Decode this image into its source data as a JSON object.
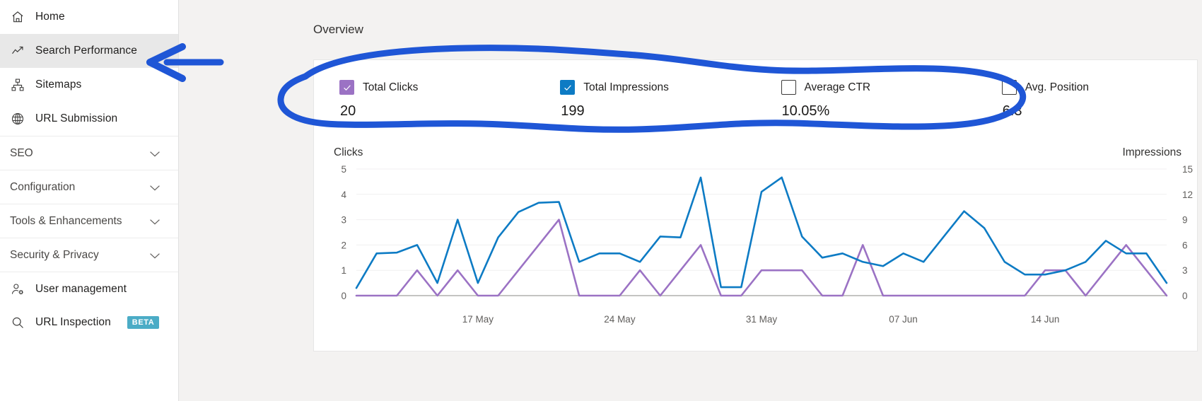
{
  "sidebar": {
    "items": [
      {
        "label": "Home",
        "icon": "home-icon",
        "type": "link",
        "active": false
      },
      {
        "label": "Search Performance",
        "icon": "trending-up-icon",
        "type": "link",
        "active": true
      },
      {
        "label": "Sitemaps",
        "icon": "sitemap-icon",
        "type": "link",
        "active": false
      },
      {
        "label": "URL Submission",
        "icon": "globe-icon",
        "type": "link",
        "active": false
      },
      {
        "label": "SEO",
        "icon": "chevron-down-icon",
        "type": "group",
        "active": false
      },
      {
        "label": "Configuration",
        "icon": "chevron-down-icon",
        "type": "group",
        "active": false
      },
      {
        "label": "Tools & Enhancements",
        "icon": "chevron-down-icon",
        "type": "group",
        "active": false
      },
      {
        "label": "Security & Privacy",
        "icon": "chevron-down-icon",
        "type": "group",
        "active": false
      },
      {
        "label": "User management",
        "icon": "user-settings-icon",
        "type": "link",
        "active": false
      },
      {
        "label": "URL Inspection",
        "icon": "search-icon",
        "type": "link",
        "active": false,
        "badge": "BETA"
      }
    ]
  },
  "main": {
    "page_title": "Overview",
    "metrics": [
      {
        "label": "Total Clicks",
        "value": "20",
        "checked": true,
        "color": "#9b72c4"
      },
      {
        "label": "Total Impressions",
        "value": "199",
        "checked": true,
        "color": "#0d7bc4"
      },
      {
        "label": "Average CTR",
        "value": "10.05%",
        "checked": false,
        "color": "#ffffff"
      },
      {
        "label": "Avg. Position",
        "value": "6.3",
        "checked": false,
        "color": "#ffffff"
      }
    ]
  },
  "chart_data": {
    "type": "line",
    "title": "",
    "xlabel": "",
    "ylabel": "Clicks",
    "y2label": "Impressions",
    "grid": true,
    "legend": "none",
    "ylim": [
      0,
      5
    ],
    "y2lim": [
      0,
      15
    ],
    "yticks": [
      0,
      1,
      2,
      3,
      4,
      5
    ],
    "y2ticks": [
      0,
      3,
      6,
      9,
      12,
      15
    ],
    "xticks": [
      "17 May",
      "24 May",
      "31 May",
      "07 Jun",
      "14 Jun"
    ],
    "xtick_positions": [
      6,
      13,
      20,
      27,
      34
    ],
    "series": [
      {
        "name": "Total Clicks",
        "color": "#9b72c4",
        "axis": "right",
        "values": [
          0,
          0,
          0,
          3,
          0,
          3,
          0,
          0,
          3,
          6,
          9,
          0,
          0,
          0,
          3,
          0,
          3,
          6,
          0,
          0,
          3,
          3,
          3,
          0,
          0,
          6,
          0,
          0,
          0,
          0,
          0,
          0,
          0,
          0,
          3,
          3,
          0,
          3,
          6,
          3,
          0
        ]
      },
      {
        "name": "Total Impressions",
        "color": "#0d7bc4",
        "axis": "right",
        "values": [
          0.9,
          5,
          5.1,
          6,
          1.5,
          9,
          1.5,
          6.9,
          9.9,
          11,
          11.1,
          4,
          5,
          5,
          4,
          7,
          6.9,
          14,
          1,
          1,
          12.3,
          14,
          7,
          4.5,
          5,
          4,
          3.5,
          5,
          4,
          7,
          10,
          8,
          4,
          2.5,
          2.5,
          3,
          4,
          6.5,
          5,
          5,
          1.5
        ]
      }
    ]
  },
  "annotations": {
    "arrow": {
      "name": "arrow-annotation",
      "color": "#1f56d6",
      "points_to": "Search Performance"
    },
    "ellipse": {
      "name": "ellipse-annotation",
      "color": "#1f56d6",
      "encircles": "metrics row"
    }
  }
}
